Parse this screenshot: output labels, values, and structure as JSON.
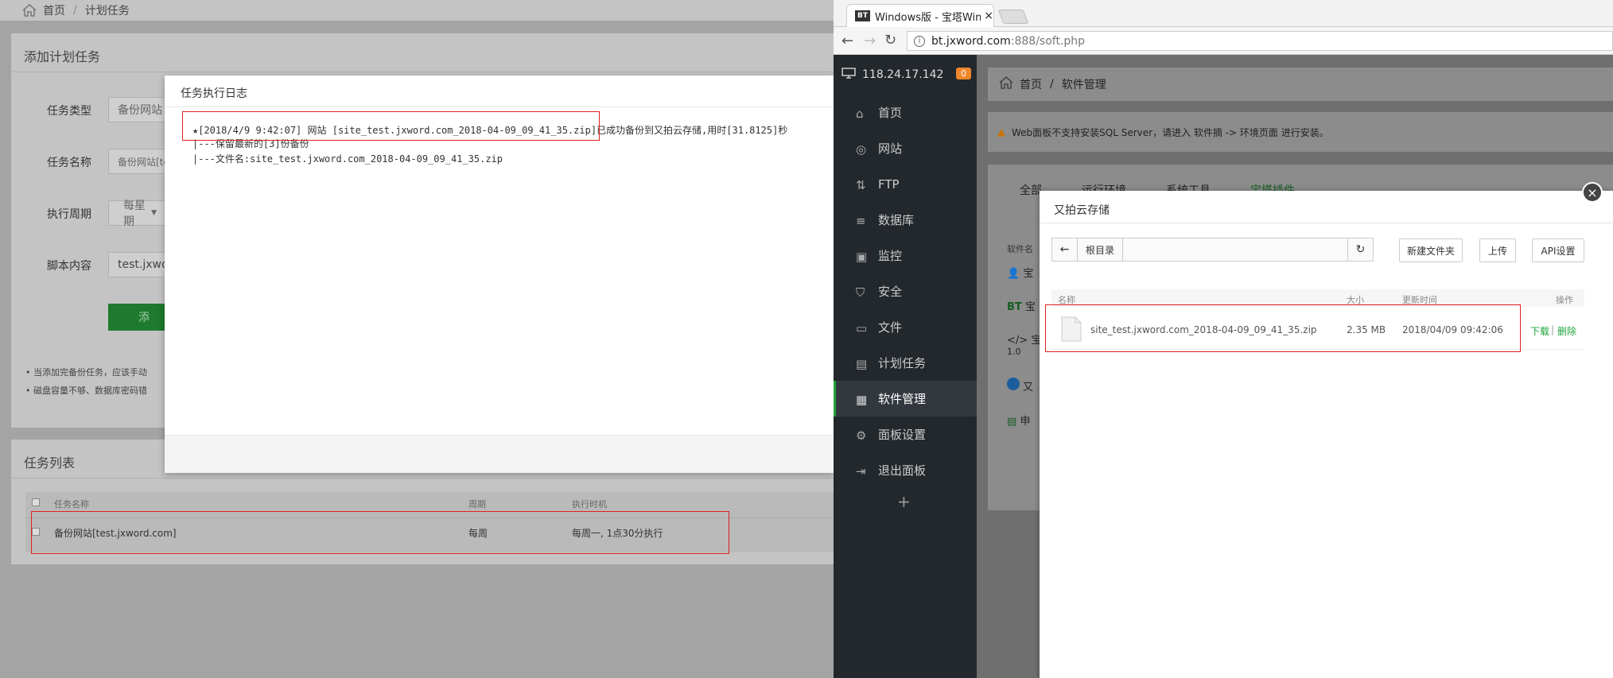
{
  "left": {
    "breadcrumb": {
      "home": "首页",
      "sep": "/",
      "current": "计划任务"
    },
    "add_task": {
      "title": "添加计划任务",
      "type_label": "任务类型",
      "type_value": "备份网站",
      "name_label": "任务名称",
      "name_value": "备份网站[te",
      "cycle_label": "执行周期",
      "cycle_value": "每星期",
      "script_label": "脚本内容",
      "script_value": "test.jxwo",
      "add_button": "添",
      "notes": [
        "当添加完备份任务，应该手动",
        "磁盘容量不够、数据库密码错"
      ]
    },
    "task_list": {
      "title": "任务列表",
      "columns": [
        "任务名称",
        "周期",
        "执行时机"
      ],
      "rows": [
        {
          "name": "备份网站[test.jxword.com]",
          "cycle": "每周",
          "when": "每周一, 1点30分执行"
        }
      ]
    },
    "log_modal": {
      "title": "任务执行日志",
      "lines": [
        "★[2018/4/9 9:42:07] 网站 [site_test.jxword.com_2018-04-09_09_41_35.zip]已成功备份到又拍云存储,用时[31.8125]秒",
        "|---保留最新的[3]份备份",
        "|---文件名:site_test.jxword.com_2018-04-09_09_41_35.zip"
      ]
    }
  },
  "browser": {
    "tab_title": "Windows版 - 宝塔Wind",
    "tab_badge": "BT",
    "url_host": "bt.jxword.com",
    "url_rest": ":888/soft.php",
    "sidebar": {
      "server_ip": "118.24.17.142",
      "badge": "0",
      "items": [
        "首页",
        "网站",
        "FTP",
        "数据库",
        "监控",
        "安全",
        "文件",
        "计划任务",
        "软件管理",
        "面板设置",
        "退出面板"
      ],
      "active_index": 8,
      "plus": "+"
    },
    "content": {
      "breadcrumb": {
        "home": "首页",
        "sep": "/",
        "current": "软件管理"
      },
      "warning": "Web面板不支持安装SQL Server，请进入 软件摘 -> 环境页面 进行安装。",
      "tabs": [
        "全部",
        "运行环境",
        "系统工具",
        "宝塔插件"
      ],
      "col_header": "软件名",
      "partial_rows": [
        "宝",
        "宝",
        "宝",
        "又",
        "申"
      ],
      "version": "1.0"
    },
    "storage": {
      "title": "又拍云存储",
      "path_root": "根目录",
      "buttons": {
        "new_folder": "新建文件夹",
        "upload": "上传",
        "api": "API设置"
      },
      "columns": {
        "name": "名称",
        "size": "大小",
        "time": "更新时间",
        "ops": "操作"
      },
      "file": {
        "name": "site_test.jxword.com_2018-04-09_09_41_35.zip",
        "size": "2.35 MB",
        "time": "2018/04/09 09:42:06",
        "download": "下载",
        "sep": "|",
        "delete": "删除"
      }
    }
  },
  "colors": {
    "accent_green": "#20a53a",
    "highlight_red": "#e02020",
    "sidebar_bg": "#23282d",
    "badge_orange": "#f0862a"
  }
}
